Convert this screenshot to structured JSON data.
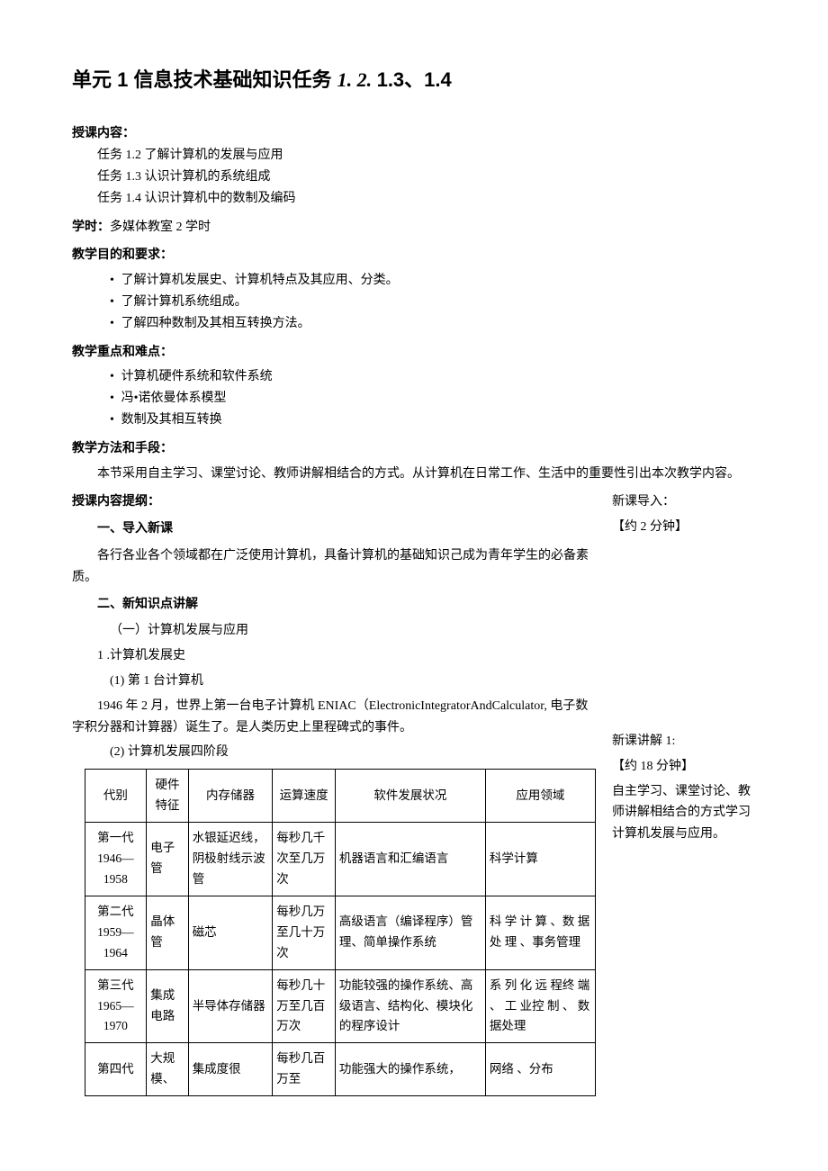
{
  "title": {
    "prefix": "单元 1 信息技术基础知识任务 ",
    "italic": "1. 2. ",
    "suffix": "1.3、1.4"
  },
  "sec_content_label": "授课内容：",
  "content_tasks": [
    "任务 1.2 了解计算机的发展与应用",
    "任务 1.3 认识计算机的系统组成",
    "任务 1.4 认识计算机中的数制及编码"
  ],
  "hours_label": "学时：",
  "hours_value": "多媒体教室 2 学时",
  "objectives_label": "教学目的和要求：",
  "objectives": [
    "了解计算机发展史、计算机特点及其应用、分类。",
    "了解计算机系统组成。",
    "了解四种数制及其相互转换方法。"
  ],
  "focus_label": "教学重点和难点：",
  "focus": [
    "计算机硬件系统和软件系统",
    "冯•诺依曼体系模型",
    "数制及其相互转换"
  ],
  "methods_label": "教学方法和手段：",
  "methods_text": "本节采用自主学习、课堂讨论、教师讲解相结合的方式。从计算机在日常工作、生活中的重要性引出本次教学内容。",
  "outline_label": "授课内容提纲：",
  "lead_in_heading": "一、导入新课",
  "lead_in_text": "各行各业各个领域都在广泛使用计算机，具备计算机的基础知识己成为青年学生的必备素质。",
  "new_knowledge_heading": "二、新知识点讲解",
  "sub1": "（一）计算机发展与应用",
  "sub1_1": "1 .计算机发展史",
  "sub1_1_1": "(1) 第 1 台计算机",
  "eniac_text": "1946 年 2 月，世界上第一台电子计算机 ENIAC（ElectronicIntegratorAndCalculator, 电子数字积分器和计算器）诞生了。是人类历史上里程碑式的事件。",
  "sub1_1_2": "(2) 计算机发展四阶段",
  "side_notes": {
    "intro_label": "新课导入：",
    "intro_time": "【约 2 分钟】",
    "lecture1_label": "新课讲解 1:",
    "lecture1_time": "【约 18 分钟】",
    "lecture1_text": "自主学习、课堂讨论、教师讲解相结合的方式学习计算机发展与应用。"
  },
  "table": {
    "headers": [
      "代别",
      "硬件特征",
      "内存储器",
      "运算速度",
      "软件发展状况",
      "应用领域"
    ],
    "rows": [
      {
        "gen": "第一代 1946—1958",
        "hw": "电子管",
        "mem": "水银延迟线，阴极射线示波管",
        "speed": "每秒几千次至几万次",
        "sw": "机器语言和汇编语言",
        "app": "科学计算"
      },
      {
        "gen": "第二代 1959—1964",
        "hw": "晶体管",
        "mem": "磁芯",
        "speed": "每秒几万至几十万次",
        "sw": "高级语言（编译程序）管 理、简单操作系统",
        "app": "科 学 计 算 、数 据 处 理 、事务管理"
      },
      {
        "gen": "第三代 1965—1970",
        "hw": "集成电路",
        "mem": "半导体存储器",
        "speed": "每秒几十万至几百万次",
        "sw": "功能较强的操作系统、高级语言、结构化、模块化的程序设计",
        "app": "系 列 化 远 程终 端 、 工 业控 制 、 数 据处理"
      },
      {
        "gen": "第四代",
        "hw": "大规模、",
        "mem": "集成度很",
        "speed": "每秒几百万至",
        "sw": "功能强大的操作系统，",
        "app": "网络 、分布"
      }
    ]
  }
}
